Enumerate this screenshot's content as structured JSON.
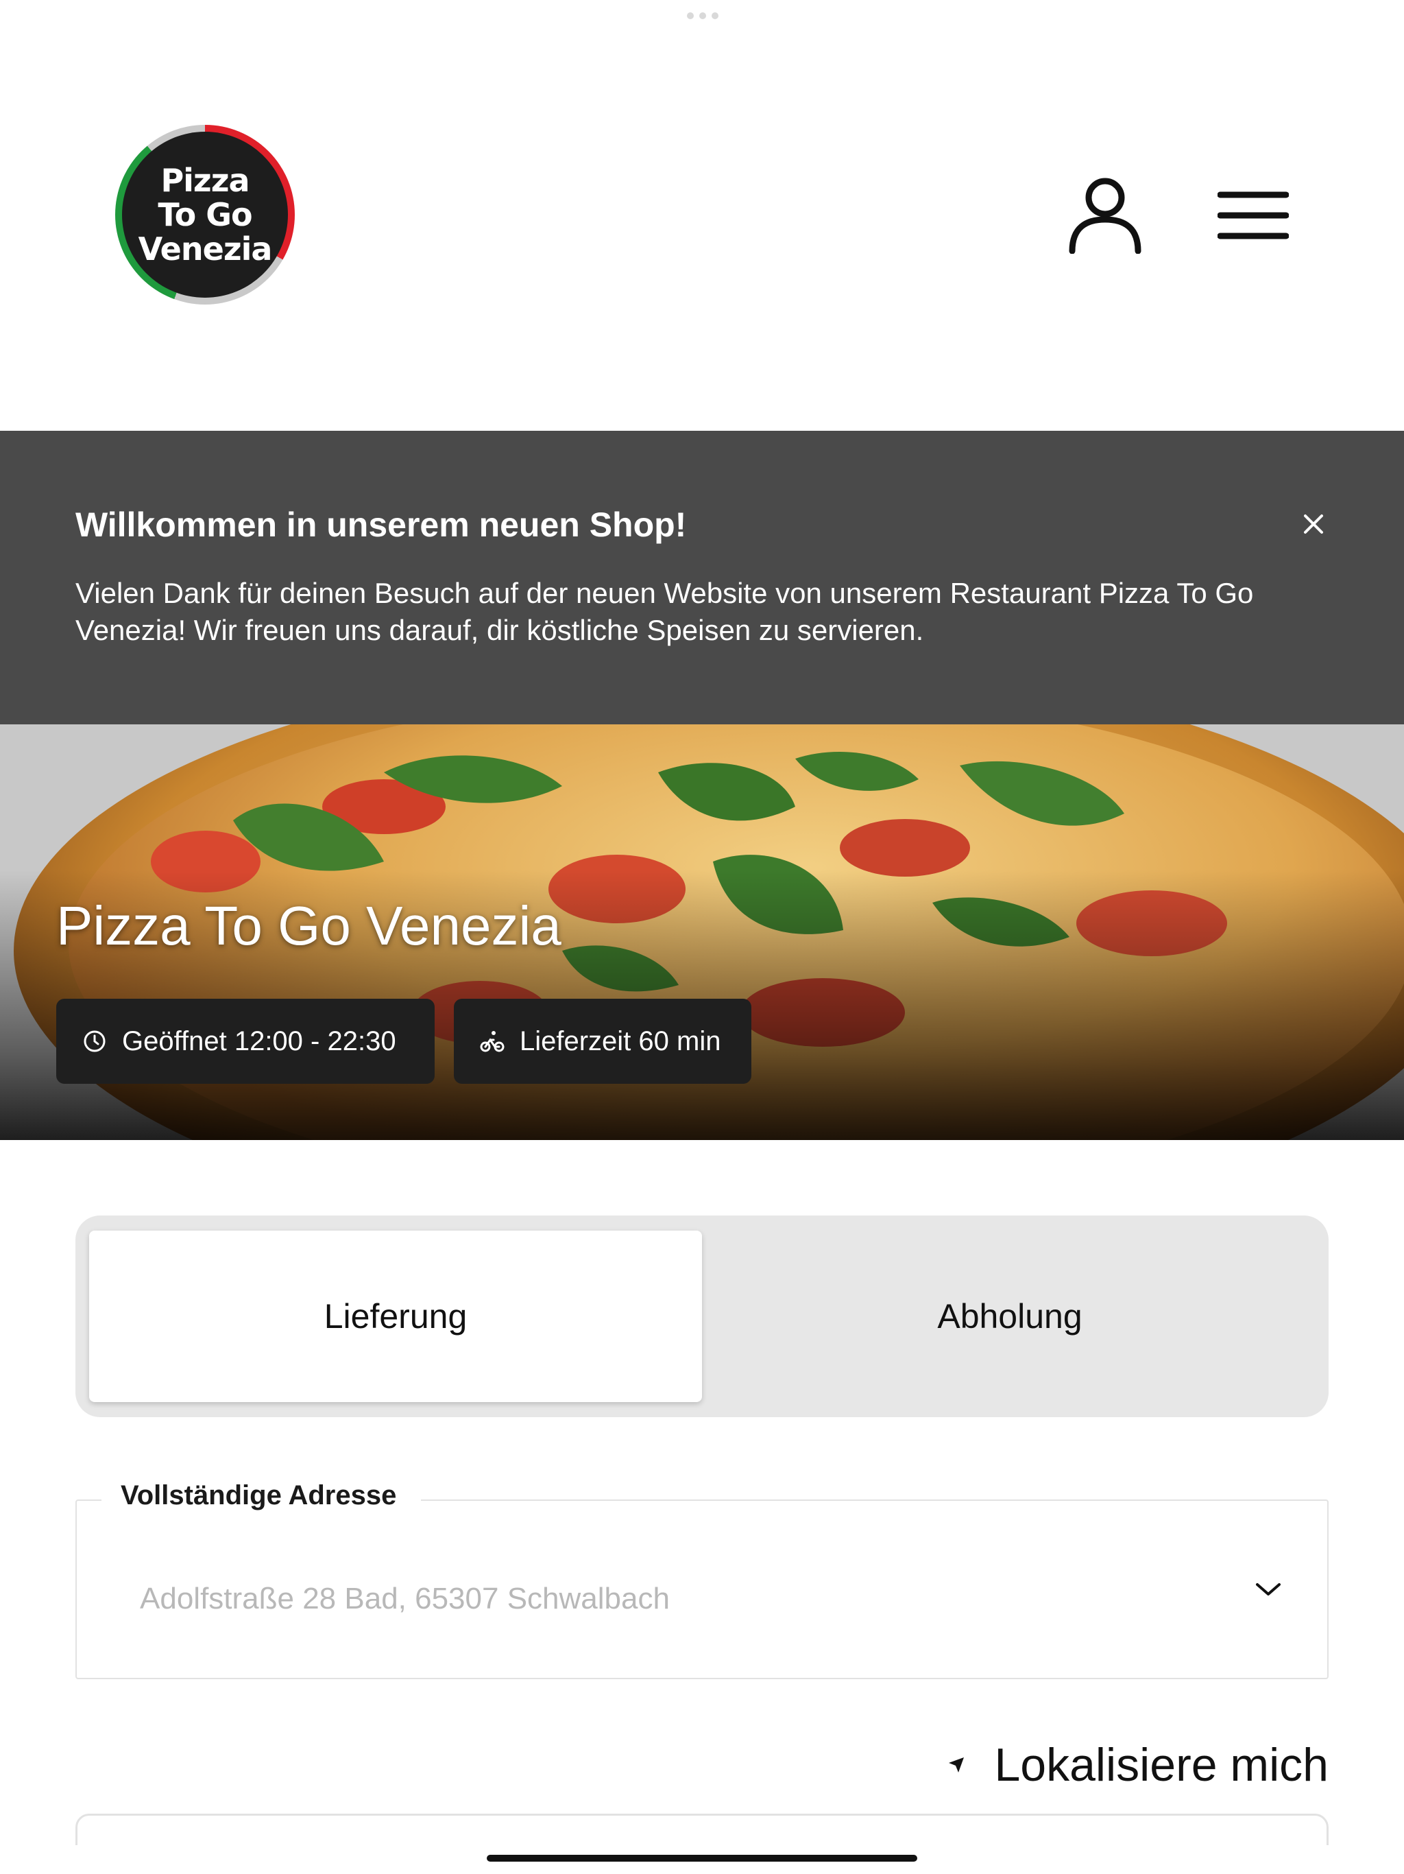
{
  "header": {
    "logo_text": "Pizza\nTo Go\nVenezia",
    "user_icon": "user-icon",
    "menu_icon": "hamburger-menu-icon"
  },
  "banner": {
    "title": "Willkommen in unserem neuen Shop!",
    "text": "Vielen Dank für deinen Besuch auf der neuen Website von unserem Restaurant Pizza To Go Venezia! Wir freuen uns darauf, dir köstliche Speisen zu servieren.",
    "close_icon": "close-icon",
    "background": "#4a4a4a"
  },
  "hero": {
    "title": "Pizza To Go Venezia",
    "opening_hours": "Geöffnet 12:00 - 22:30",
    "delivery_time": "Lieferzeit 60 min",
    "clock_icon": "clock-icon",
    "delivery_icon": "bicycle-icon"
  },
  "mode_switch": {
    "options": [
      "Lieferung",
      "Abholung"
    ],
    "selected": "Lieferung"
  },
  "address": {
    "label": "Vollständige Adresse",
    "value": "",
    "placeholder": "Adolfstraße 28 Bad, 65307 Schwalbach",
    "chevron_icon": "chevron-down-icon"
  },
  "locate": {
    "label": "Lokalisiere mich",
    "icon": "location-arrow-icon"
  }
}
